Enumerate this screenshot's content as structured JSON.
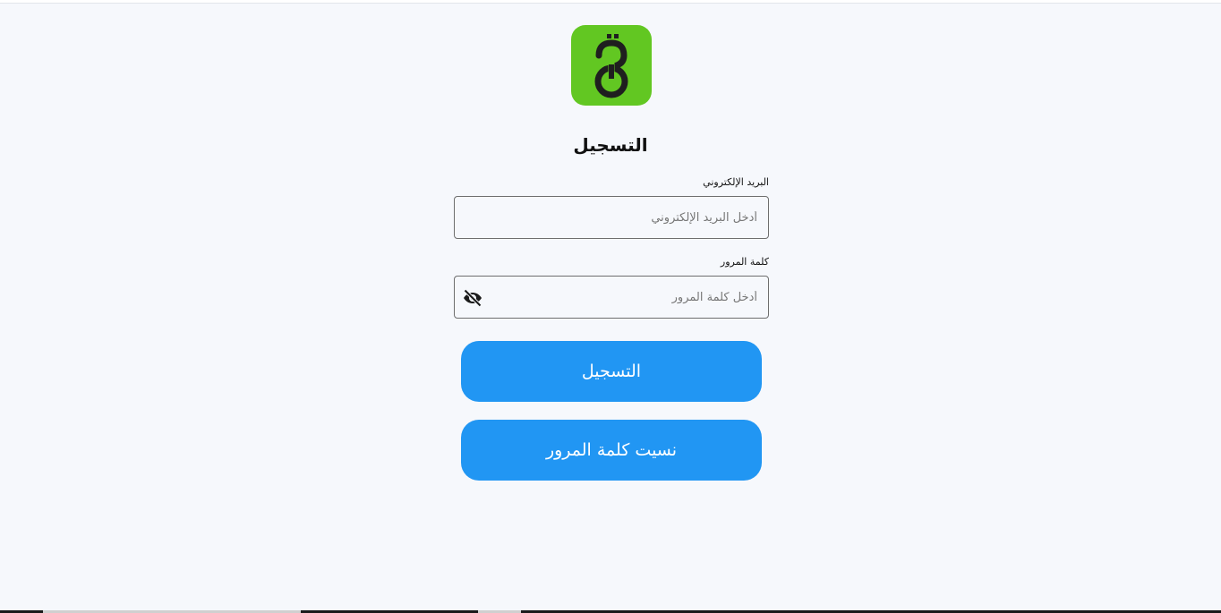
{
  "page": {
    "title": "التسجيل"
  },
  "form": {
    "email": {
      "label": "البريد الإلكتروني",
      "placeholder": "أدخل البريد الإلكتروني",
      "value": ""
    },
    "password": {
      "label": "كلمة المرور",
      "placeholder": "أدخل كلمة المرور",
      "value": "",
      "toggle_icon": "eye-off-icon"
    }
  },
  "buttons": {
    "login_label": "التسجيل",
    "forgot_label": "نسيت كلمة المرور"
  },
  "colors": {
    "brand_green": "#62c722",
    "primary_blue": "#2196f3",
    "background": "#f6f8fc"
  }
}
